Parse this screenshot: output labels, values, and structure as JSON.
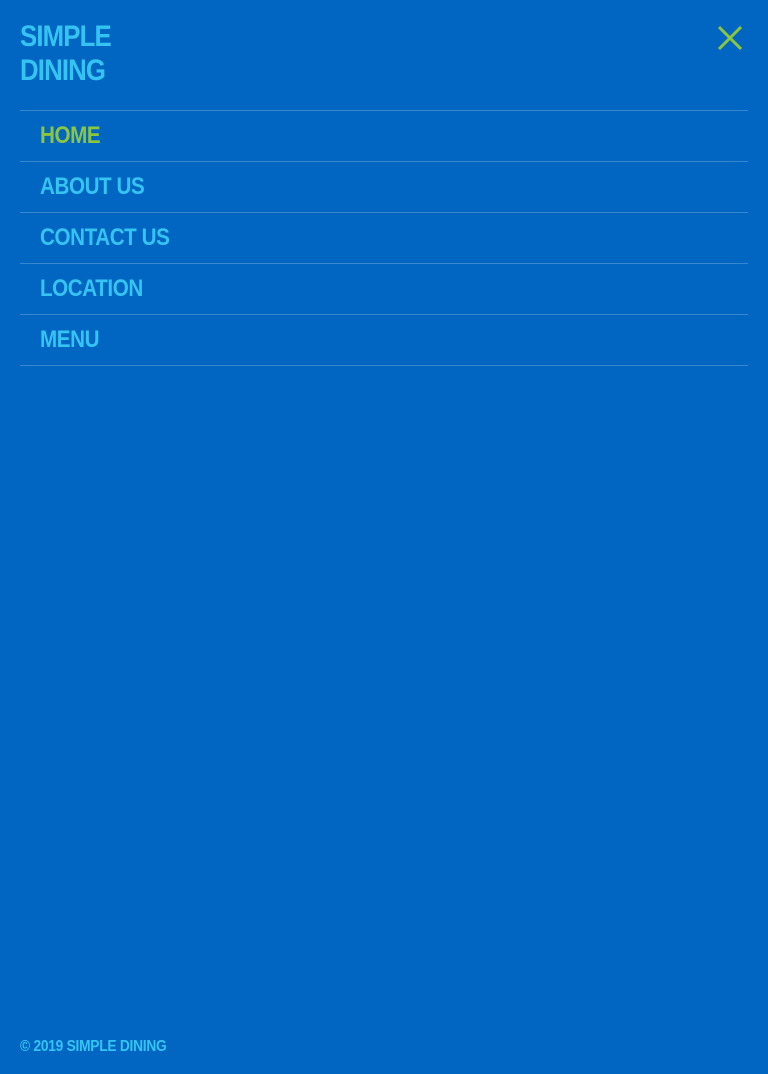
{
  "brand": {
    "line1": "SIMPLE",
    "line2": "DINING"
  },
  "close_icon": "close-icon",
  "nav": {
    "items": [
      {
        "label": "HOME",
        "active": true
      },
      {
        "label": "ABOUT US",
        "active": false
      },
      {
        "label": "CONTACT US",
        "active": false
      },
      {
        "label": "LOCATION",
        "active": false
      },
      {
        "label": "MENU",
        "active": false
      }
    ]
  },
  "footer": {
    "copyright": "© 2019 SIMPLE DINING"
  },
  "colors": {
    "background": "#0166c2",
    "text": "#35c4f2",
    "accent": "#8cc63f"
  }
}
